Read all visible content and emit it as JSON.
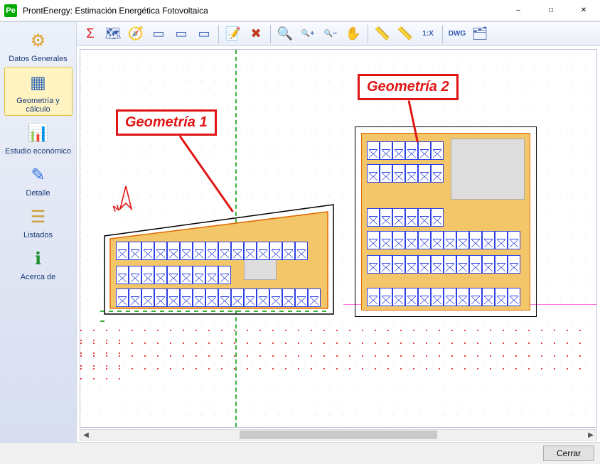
{
  "window": {
    "app_icon_text": "Pe",
    "title": "ProntEnergy: Estimación Energética Fotovoltaica"
  },
  "sidebar": {
    "items": [
      {
        "label": "Datos Generales",
        "icon": "gear-icon",
        "selected": false
      },
      {
        "label": "Geometría y cálculo",
        "icon": "geometry-icon",
        "selected": true
      },
      {
        "label": "Estudio económico",
        "icon": "economy-icon",
        "selected": false
      },
      {
        "label": "Detalle",
        "icon": "detail-icon",
        "selected": false
      },
      {
        "label": "Listados",
        "icon": "list-icon",
        "selected": false
      },
      {
        "label": "Acerca de",
        "icon": "about-icon",
        "selected": false
      }
    ]
  },
  "toolbar": {
    "buttons": [
      {
        "name": "sigma-icon",
        "glyph": "Σ",
        "color": "#e01515"
      },
      {
        "name": "project-icon",
        "glyph": "🗺"
      },
      {
        "name": "compass-icon",
        "glyph": "🧭"
      },
      {
        "name": "edit-rect-green-icon",
        "glyph": "▭"
      },
      {
        "name": "edit-rect-black-icon",
        "glyph": "▭"
      },
      {
        "name": "edit-rect-colors-icon",
        "glyph": "▭"
      },
      {
        "name": "sep"
      },
      {
        "name": "form-edit-icon",
        "glyph": "📝"
      },
      {
        "name": "delete-icon",
        "glyph": "✖",
        "color": "#c23a1e"
      },
      {
        "name": "sep"
      },
      {
        "name": "zoom-fit-icon",
        "glyph": "🔍"
      },
      {
        "name": "zoom-in-icon",
        "glyph": "🔍+"
      },
      {
        "name": "zoom-out-icon",
        "glyph": "🔍−"
      },
      {
        "name": "pan-icon",
        "glyph": "✋"
      },
      {
        "name": "sep"
      },
      {
        "name": "ruler-h-icon",
        "glyph": "📏"
      },
      {
        "name": "ruler-unit-icon",
        "glyph": "📏"
      },
      {
        "name": "scale-1x-icon",
        "glyph": "1:X"
      },
      {
        "name": "sep"
      },
      {
        "name": "dwg-icon",
        "glyph": "DWG"
      },
      {
        "name": "layers-icon",
        "glyph": "🗂"
      }
    ]
  },
  "annotations": {
    "geo1": "Geometría 1",
    "geo2": "Geometría 2"
  },
  "north_label": "N",
  "footer": {
    "close_label": "Cerrar"
  }
}
